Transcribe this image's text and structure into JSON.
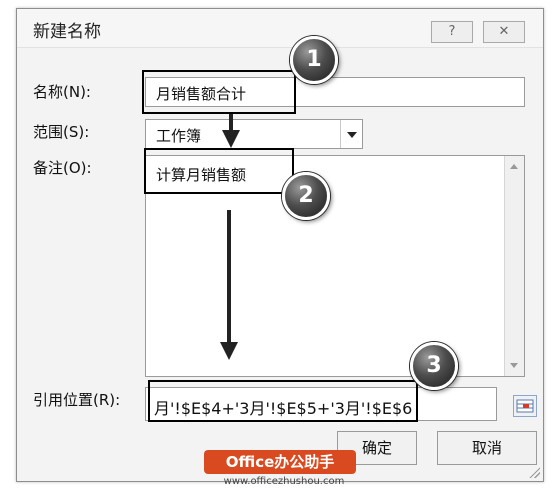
{
  "dialog": {
    "title": "新建名称",
    "help_label": "?",
    "close_label": "✕",
    "name_label": "名称(N):",
    "name_value": "月销售额合计",
    "scope_label": "范围(S):",
    "scope_value": "工作簿",
    "comment_label": "备注(O):",
    "comment_value": "计算月销售额",
    "refers_to_label": "引用位置(R):",
    "refers_to_value": "月'!$E$4+'3月'!$E$5+'3月'!$E$6",
    "ok_label": "确定",
    "cancel_label": "取消"
  },
  "annotations": {
    "step1": "1",
    "step2": "2",
    "step3": "3"
  },
  "watermark": {
    "brand": "Office办公助手",
    "url": "www.officezhushou.com"
  },
  "colors": {
    "dialog_bg": "#f3f3f3",
    "badge_dark": "#333333",
    "watermark_bg": "#d94a20"
  }
}
